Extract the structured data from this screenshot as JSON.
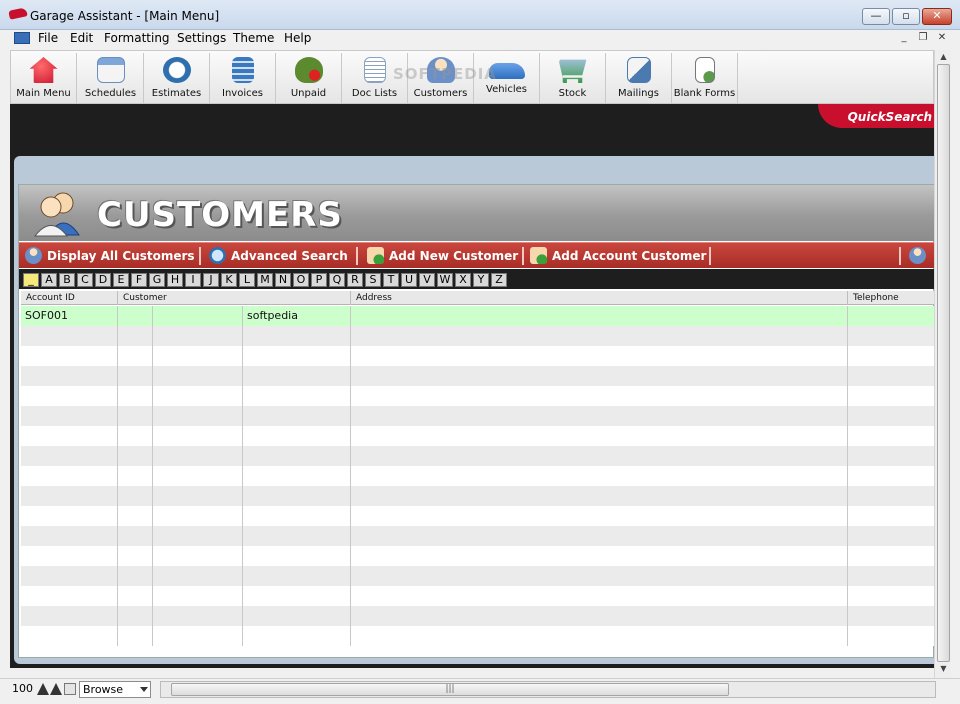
{
  "window": {
    "title": "Garage Assistant - [Main Menu]",
    "buttons": [
      "minimize",
      "maximize",
      "close"
    ]
  },
  "menu": {
    "items": [
      "File",
      "Edit",
      "Formatting",
      "Settings",
      "Theme",
      "Help"
    ]
  },
  "toolbar": {
    "items": [
      {
        "label": "Main Menu",
        "icon": "house-icon",
        "color": "#c8102e"
      },
      {
        "label": "Schedules",
        "icon": "calendar-icon",
        "color": "#6a8fbf"
      },
      {
        "label": "Estimates",
        "icon": "clock-icon",
        "color": "#2f6fad"
      },
      {
        "label": "Invoices",
        "icon": "calculator-icon",
        "color": "#3a78c0"
      },
      {
        "label": "Unpaid",
        "icon": "money-bag-icon",
        "color": "#5b8a2f"
      },
      {
        "label": "Doc Lists",
        "icon": "document-list-icon",
        "color": "#8aa2c0"
      },
      {
        "label": "Customers",
        "icon": "customers-icon",
        "color": "#6b8fc7"
      },
      {
        "label": "Vehicles",
        "icon": "car-icon",
        "color": "#2f6fc0"
      },
      {
        "label": "Stock",
        "icon": "shopping-cart-icon",
        "color": "#3a9a4a"
      },
      {
        "label": "Mailings",
        "icon": "mail-icon",
        "color": "#4a7ab0"
      },
      {
        "label": "Blank Forms",
        "icon": "blank-form-icon",
        "color": "#5a9a4a"
      }
    ],
    "watermark": "SOFTPEDIA"
  },
  "quicksearch": {
    "label": "QuickSearch"
  },
  "page": {
    "title": "CUSTOMERS",
    "actions": [
      {
        "label": "Display All Customers",
        "icon": "customers-icon"
      },
      {
        "label": "Advanced Search",
        "icon": "magnifier-icon"
      },
      {
        "label": "Add New Customer",
        "icon": "add-customer-icon"
      },
      {
        "label": "Add Account Customer",
        "icon": "add-account-customer-icon"
      }
    ]
  },
  "alphabet": {
    "selected": "_",
    "letters": [
      "_",
      "A",
      "B",
      "C",
      "D",
      "E",
      "F",
      "G",
      "H",
      "I",
      "J",
      "K",
      "L",
      "M",
      "N",
      "O",
      "P",
      "Q",
      "R",
      "S",
      "T",
      "U",
      "V",
      "W",
      "X",
      "Y",
      "Z"
    ]
  },
  "table": {
    "columns": [
      "Account ID",
      "Customer",
      "Address",
      "Telephone"
    ],
    "rows": [
      {
        "account_id": "SOF001",
        "customer": "softpedia",
        "address": "",
        "telephone": ""
      }
    ],
    "empty_rows": 16
  },
  "status": {
    "zoom": "100",
    "mode": "Browse",
    "colors": {
      "accent": "#c8102e",
      "action_bar": "#b3322b",
      "selected_row": "#ccffcc"
    }
  }
}
